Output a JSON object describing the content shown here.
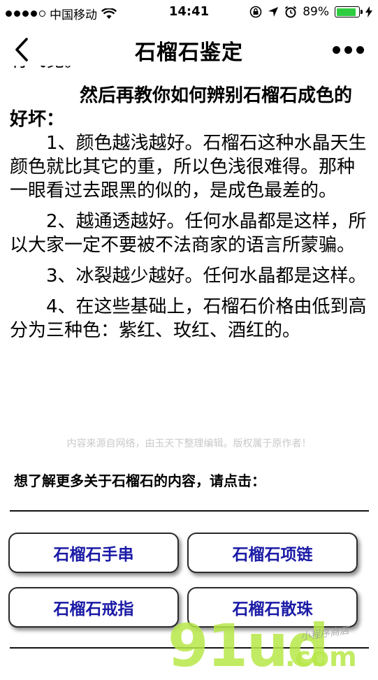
{
  "status_bar": {
    "carrier": "中国移动",
    "time": "14:41",
    "battery": "89%",
    "battery_level": 0.89,
    "icons": [
      "signal-icon",
      "wifi-icon",
      "rotation-lock-icon",
      "location-icon",
      "alarm-icon",
      "battery-icon",
      "charging-icon"
    ]
  },
  "nav": {
    "title": "石榴石鉴定",
    "back_icon": "chevron-left-icon",
    "more_icon": "more-dots-icon"
  },
  "article": {
    "clipped_fragment": "有飞觉。",
    "heading": "然后再教你如何辨别石榴石成色的好坏：",
    "points": [
      "1、颜色越浅越好。石榴石这种水晶天生颜色就比其它的重，所以色浅很难得。那种一眼看过去跟黑的似的，是成色最差的。",
      "2、越通透越好。任何水晶都是这样，所以大家一定不要被不法商家的语言所蒙骗。",
      "3、冰裂越少越好。任何水晶都是这样。",
      "4、在这些基础上，石榴石价格由低到高分为三种色：紫红、玫红、酒红的。"
    ],
    "source_note": "内容来源自网络，由玉天下整理编辑。版权属于原作者！"
  },
  "links": {
    "prompt": "想了解更多关于石榴石的内容，请点击：",
    "buttons": [
      "石榴石手串",
      "石榴石项链",
      "石榴石戒指",
      "石榴石散珠"
    ]
  },
  "watermark": {
    "logo": "91ud",
    "domain": ".com",
    "small": "小程序商店"
  },
  "colors": {
    "button_text": "#1a1aa6",
    "battery": "#2ecc40",
    "watermark": "#b8e84a"
  }
}
